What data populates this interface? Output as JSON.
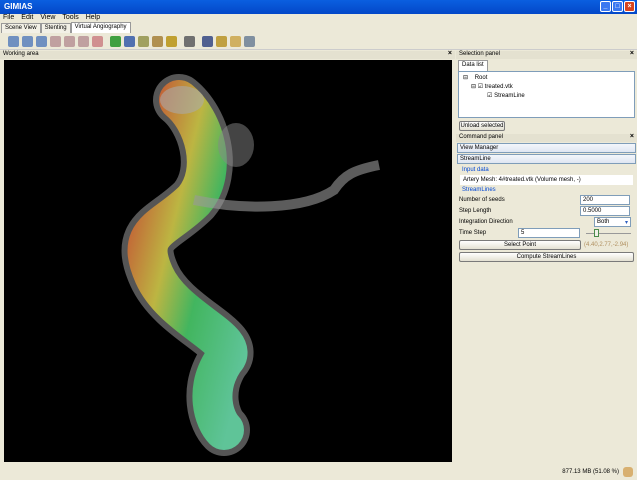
{
  "app": {
    "title": "GIMIAS"
  },
  "menu": [
    "File",
    "Edit",
    "View",
    "Tools",
    "Help"
  ],
  "tabs": [
    "Scene View",
    "Stenting",
    "Virtual Angiography"
  ],
  "toolbar_icons": [
    "layout-1-icon",
    "layout-2-icon",
    "layout-3-icon",
    "view-x-icon",
    "view-y-icon",
    "view-z-icon",
    "view-3d-icon",
    "recycle-icon",
    "move-icon",
    "axis-icon",
    "lock-icon",
    "eye-icon",
    "camera-icon",
    "sphere-icon",
    "cylinder-icon",
    "plane-icon",
    "lasso-icon"
  ],
  "working_area": {
    "title": "Working area"
  },
  "selection_panel": {
    "title": "Selection panel",
    "tab": "Data list",
    "tree": {
      "root": "Root",
      "child": "treated.vtk",
      "grandchild": "StreamLine"
    },
    "unload": "Unload selected"
  },
  "command_panel": {
    "title": "Command panel",
    "view_manager": "View Manager",
    "streamline": "StreamLine",
    "input_data_label": "Input data",
    "artery_mesh": "Artery Mesh: 4#treated.vtk (Volume mesh, -)",
    "streamlines_label": "StreamLines",
    "num_seeds_label": "Number of seeds",
    "num_seeds": "200",
    "step_length_label": "Step Length",
    "step_length": "0.5000",
    "integration_label": "Integration Direction",
    "integration": "Both",
    "time_step_label": "Time Step",
    "time_step": "5",
    "select_point": "Select Point",
    "point_coords": "(4.40,2.77,-2.94)",
    "compute": "Compute StreamLines"
  },
  "status": {
    "memory": "877.13 MB (51.08 %)"
  }
}
